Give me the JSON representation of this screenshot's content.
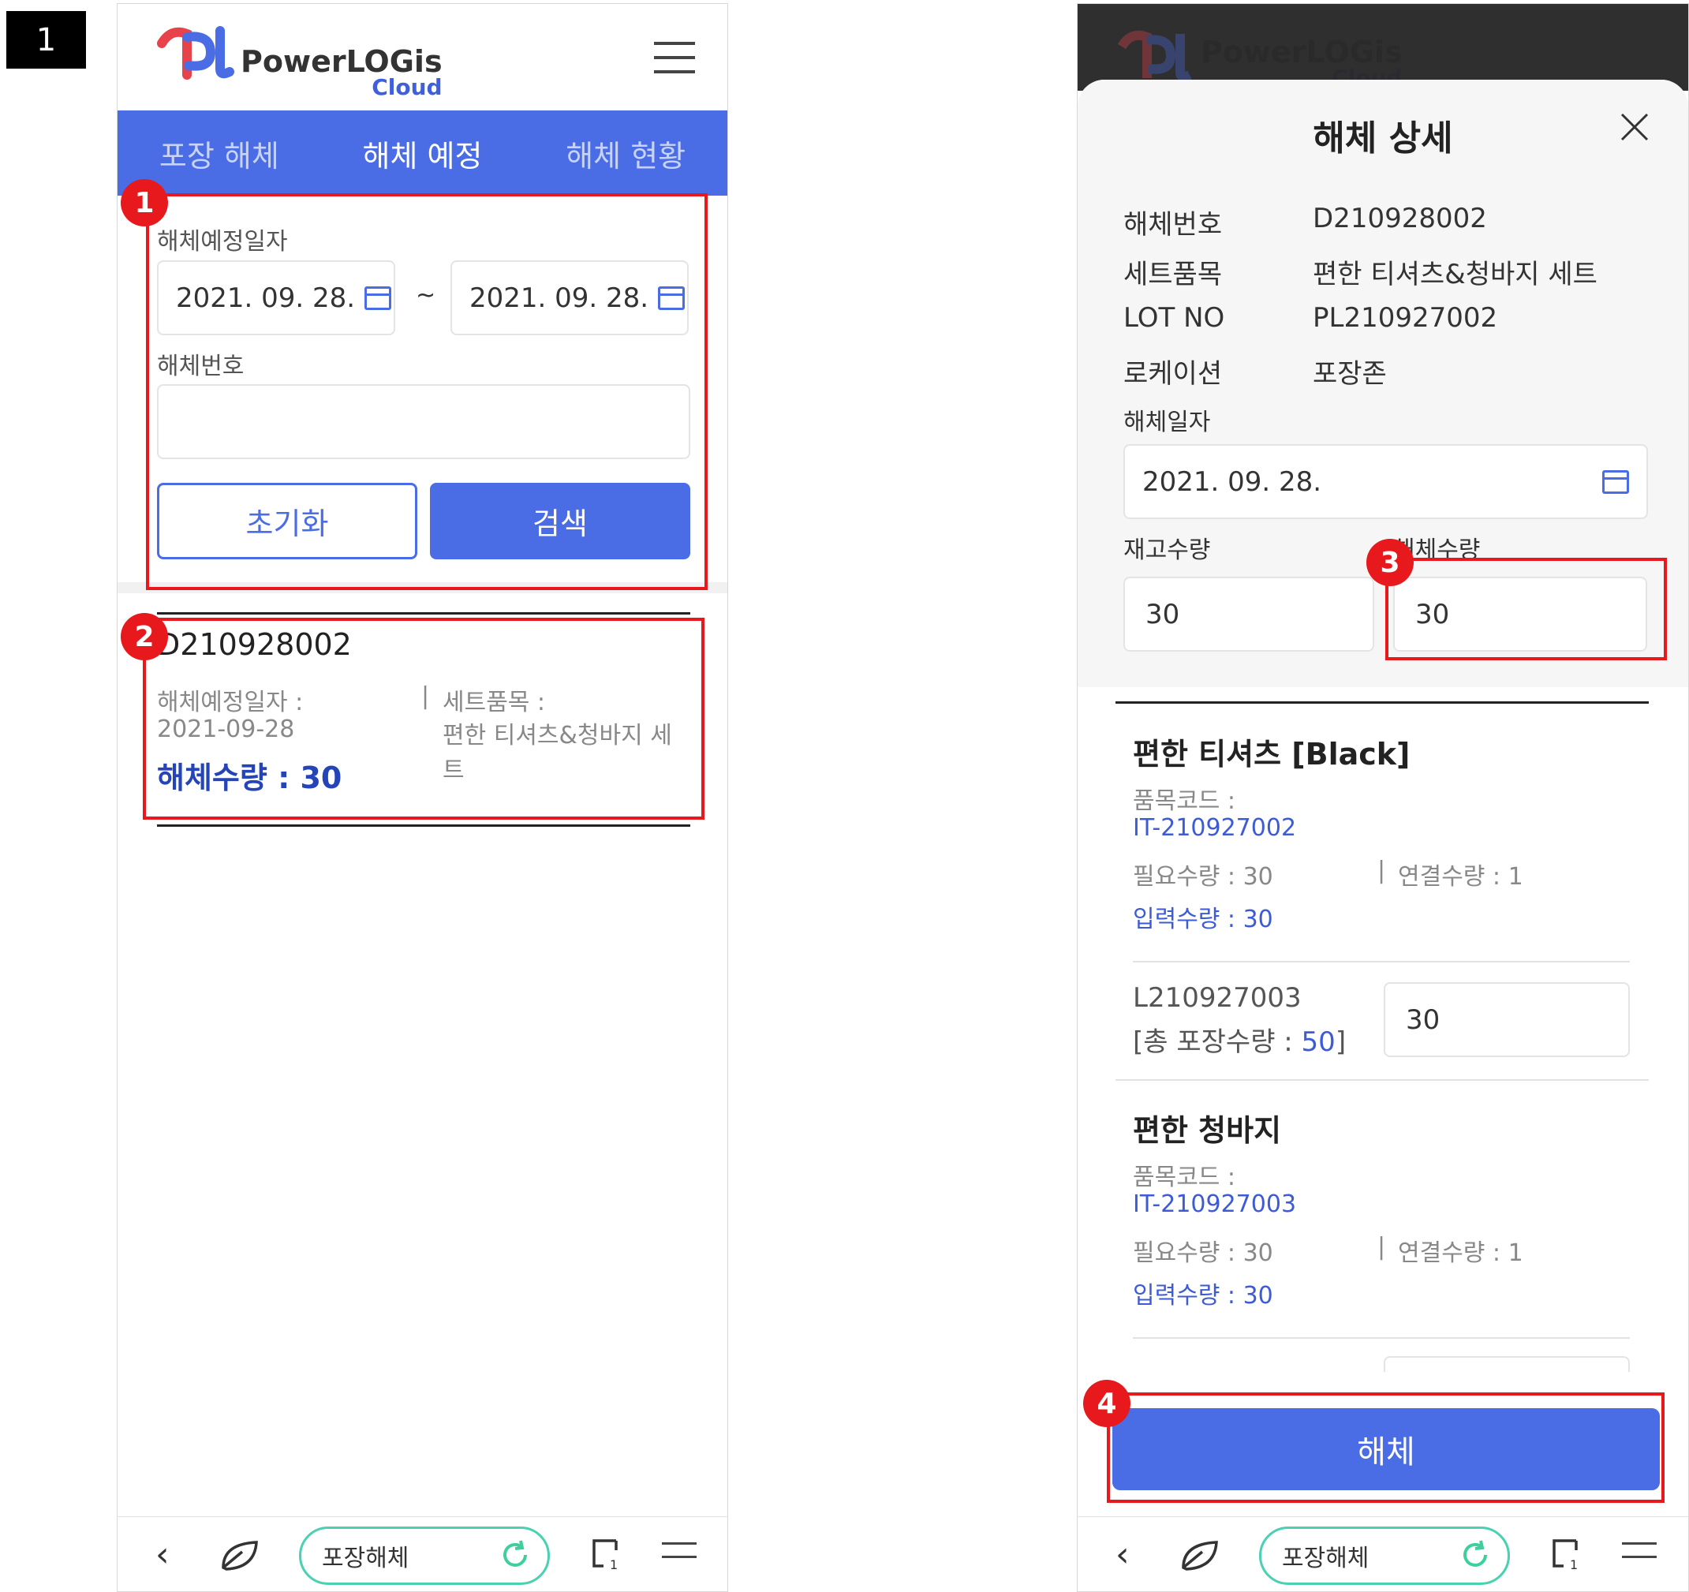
{
  "page_badge": "1",
  "left": {
    "logo": {
      "text": "PowerLOGis",
      "sub": "Cloud"
    },
    "tabs": [
      "포장 해체",
      "해체 예정",
      "해체 현황"
    ],
    "search": {
      "date_label": "해체예정일자",
      "date_from": "2021. 09. 28.",
      "tilde": "~",
      "date_to": "2021. 09. 28.",
      "number_label": "해체번호",
      "number_value": "",
      "reset_label": "초기화",
      "search_label": "검색"
    },
    "result": {
      "id": "D210928002",
      "date_label": "해체예정일자 :",
      "date_value": "2021-09-28",
      "set_label": "세트품목 :",
      "set_value": "편한 티셔츠&청바지 세트",
      "qty": "해체수량 : 30"
    },
    "nav": {
      "pill_label": "포장해체"
    }
  },
  "right": {
    "title": "해체 상세",
    "details": [
      {
        "label": "해체번호",
        "value": "D210928002"
      },
      {
        "label": "세트품목",
        "value": "편한 티셔츠&청바지 세트"
      },
      {
        "label": "LOT NO",
        "value": "PL210927002"
      },
      {
        "label": "로케이션",
        "value": "포장존"
      }
    ],
    "date_label": "해체일자",
    "date_value": "2021. 09. 28.",
    "stock_label": "재고수량",
    "stock_value": "30",
    "disassemble_label": "해체수량",
    "disassemble_value": "30",
    "items": [
      {
        "title": "편한 티셔츠 [Black]",
        "code_label": "품목코드 :",
        "code": "IT-210927002",
        "required": "필요수량 : 30",
        "linked": "연결수량 : 1",
        "input_label": "입력수량 : ",
        "input_value": "30",
        "lot": "L210927003",
        "lot_total_prefix": "[총 포장수량 : ",
        "lot_total": "50",
        "lot_total_suffix": "]",
        "lot_input": "30"
      },
      {
        "title": "편한 청바지",
        "code_label": "품목코드 :",
        "code": "IT-210927003",
        "required": "필요수량 : 30",
        "linked": "연결수량 : 1",
        "input_label": "입력수량 : ",
        "input_value": "30"
      }
    ],
    "submit_label": "해체",
    "nav": {
      "pill_label": "포장해체"
    }
  },
  "callouts": [
    "1",
    "2",
    "3",
    "4"
  ],
  "colors": {
    "primary": "#4a6de5",
    "highlight": "#e8191c",
    "link": "#3e5bd6"
  }
}
